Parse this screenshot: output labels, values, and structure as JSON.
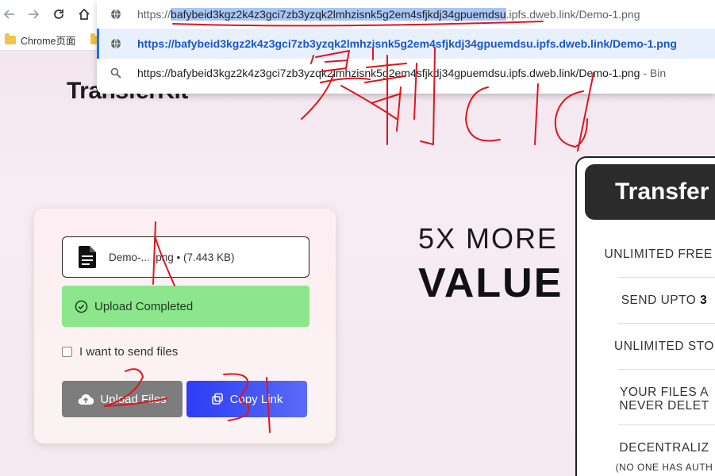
{
  "browser": {
    "back_label": "←",
    "forward_label": "→",
    "reload_label": "⟳",
    "home_label": "⌂",
    "bookmark_label": "Chrome页面",
    "omnibox": {
      "input_prefix": "https://",
      "input_highlight": "bafybeid3kgz2k4z3gci7zb3yzqk2lmhzisnk5g2em4sfjkdj34gpuemdsu",
      "input_suffix": ".ipfs.dweb.link/Demo-1.png",
      "selected_suggestion": "https://bafybeid3kgz2k4z3gci7zb3yzqk2lmhzisnk5g2em4sfjkdj34gpuemdsu.ipfs.dweb.link/Demo-1.png",
      "search_suggestion": "https://bafybeid3kgz2k4z3gci7zb3yzqk2lmhzisnk5g2em4sfjkdj34gpuemdsu.ipfs.dweb.link/Demo-1.png",
      "search_suggestion_suffix": " - Bin"
    }
  },
  "page": {
    "brand": "TransferKit",
    "card": {
      "file_name": "Demo-... .png • (7.443 KB)",
      "upload_status": "Upload Completed",
      "send_files_label": "I want to send files",
      "upload_button": "Upload Files",
      "copy_button": "Copy Link"
    },
    "hero": {
      "line1": "5X MORE",
      "line2": "VALUE"
    },
    "panel": {
      "title": "Transfer",
      "features": [
        {
          "text": "UNLIMITED FREE ",
          "bold": "F"
        },
        {
          "text": "SEND UPTO ",
          "bold": "3"
        },
        {
          "text": "UNLIMITED STO",
          "bold": ""
        },
        {
          "text": "YOUR FILES A",
          "bold": ""
        },
        {
          "text": "NEVER DELET",
          "bold": ""
        },
        {
          "text": "DECENTRALIZ",
          "bold": ""
        },
        {
          "text": "(NO ONE HAS AUTH",
          "bold": ""
        }
      ]
    }
  },
  "annotations": {
    "label_1": "1",
    "label_2": "2",
    "label_3": "3",
    "handwriting": "复制 cid",
    "color": "#e0141e"
  },
  "colors": {
    "upload_success": "#8ce68c",
    "copy_button": "#2b3cf6",
    "upload_button": "#7d7d7d",
    "omnibox_highlight": "#a9c7f6"
  }
}
